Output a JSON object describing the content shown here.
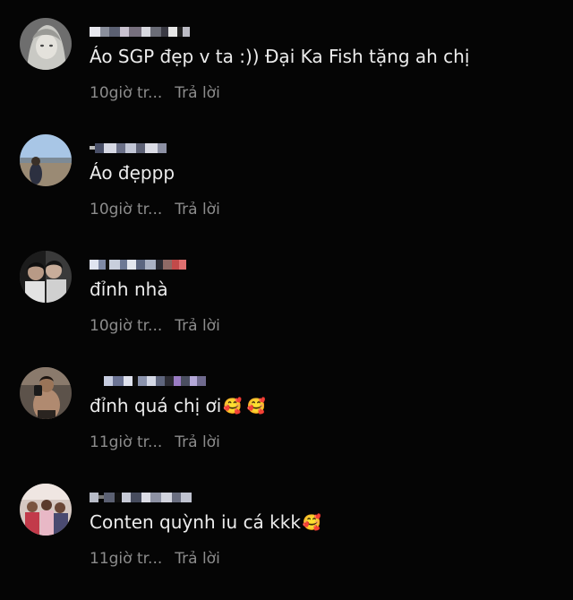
{
  "comments": [
    {
      "avatar": "avatar-anime-character",
      "text": "Áo SGP đẹp v ta :)) Đại Ka Fish tặng ah chị",
      "emoji": "",
      "time": "10giờ tr...",
      "reply_label": "Trả lời"
    },
    {
      "avatar": "avatar-landscape",
      "text": "Áo đẹppp",
      "emoji": "",
      "time": "10giờ tr...",
      "reply_label": "Trả lời"
    },
    {
      "avatar": "avatar-couple-photo",
      "text": "đỉnh nhà",
      "emoji": "",
      "time": "10giờ tr...",
      "reply_label": "Trả lời"
    },
    {
      "avatar": "avatar-mirror-selfie",
      "text": "đỉnh quá chị ơi",
      "emoji": "🥰 🥰",
      "time": "11giờ tr...",
      "reply_label": "Trả lời"
    },
    {
      "avatar": "avatar-group-photo",
      "text": "Conten quỳnh iu cá kkk",
      "emoji": "🥰",
      "time": "11giờ tr...",
      "reply_label": "Trả lời"
    }
  ],
  "colors": {
    "background": "#050505",
    "text": "#ececec",
    "meta": "#8c8c8c"
  }
}
